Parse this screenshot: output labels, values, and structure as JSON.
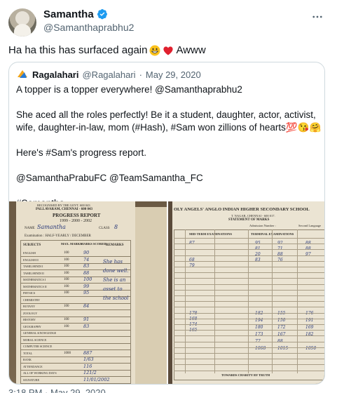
{
  "tweet": {
    "author_name": "Samantha",
    "author_handle": "@Samanthaprabhu2",
    "text": "Ha ha this has surfaced again",
    "text_tail": "Awww",
    "emojis": [
      "grinning-face",
      "red-heart"
    ]
  },
  "quote": {
    "author_name": "Ragalahari",
    "author_handle": "@Ragalahari",
    "separator": "·",
    "date": "May 29, 2020",
    "paragraphs": [
      "A topper is a topper everywhere! @Samanthaprabhu2",
      "She aced all the roles perfectly! Be it a student, daughter, actor, activist, wife, daughter-in-law, mom (#Hash), #Sam won zillions of hearts💯😘🤗",
      "Here's #Sam's progress report.",
      "@SamanthaPrabuFC @TeamSamantha_FC",
      "#Samantha"
    ]
  },
  "report_left": {
    "header_small": "RECOGNISED BY THE GOVT. 600 043",
    "header_place": "PALLAVARAM, CHENNAI - 600 043",
    "title": "PROGRESS REPORT",
    "year": "1999 - 2000 - 2002",
    "name_label": "NAME",
    "name_value": "Samantha",
    "class_label": "CLASS",
    "class_value": "8",
    "exam": "Examination : HALF-YEARLY / DECEMBER",
    "col_subjects": "SUBJECTS",
    "col_max": "MAX. MARKS",
    "col_scored": "MARKS SCORED",
    "col_remarks": "REMARKS",
    "subjects": [
      "ENGLISH",
      "ENGLISH II",
      "TAMIL/HINDI I",
      "TAMIL/HINDI II",
      "MATHEMATICS I",
      "MATHEMATICS II",
      "PHYSICS",
      "CHEMISTRY",
      "BOTANY",
      "ZOOLOGY",
      "HISTORY",
      "GEOGRAPHY",
      "GENERAL KNOWLEDGE",
      "MORAL SCIENCE",
      "COMPUTER SCIENCE",
      "TOTAL",
      "RANK",
      "ATTENDANCE",
      "ALL OF WORKING DAYS",
      "SIGNATURE"
    ],
    "max": [
      "100",
      "100",
      "100",
      "100",
      "100",
      "100",
      "100",
      "",
      "100",
      "",
      "100",
      "100",
      "",
      "",
      "",
      "1000",
      "",
      "",
      "",
      ""
    ],
    "scored": [
      "90",
      "74",
      "83",
      "88",
      "100",
      "99",
      "95",
      "",
      "84",
      "",
      "91",
      "83",
      "",
      "",
      "",
      "887",
      "1/63",
      "116",
      "121/2",
      "11/01/2002"
    ],
    "remarks": [
      "She has",
      "done well.",
      "She is an",
      "asset to",
      "the school"
    ]
  },
  "report_right": {
    "school": "OLY ANGELS' ANGLO INDIAN HIGHER SECONDARY SCHOOL",
    "address": "T. NAGAR, CHENNAI - 600 017.",
    "statement": "STATEMENT OF MARKS",
    "admission": "Admission Number :",
    "second_lang": "Second Language",
    "mid_term": "MID-TERM EXAMINATIONS",
    "terminal": "TERMINAL EXAMINATIONS",
    "mid_rows": [
      "87",
      "",
      "",
      "68",
      "79"
    ],
    "t1": [
      "95",
      "81",
      "20",
      "83"
    ],
    "t2": [
      "92",
      "71",
      "88",
      "76"
    ],
    "t3": [
      "88",
      "88",
      "97",
      ""
    ],
    "lower_mid": [
      "178",
      "168",
      "174",
      "165"
    ],
    "lower_a": [
      "182",
      "194",
      "180",
      "173",
      "77",
      "1068"
    ],
    "lower_b": [
      "155",
      "150",
      "172",
      "167",
      "88",
      "1015"
    ],
    "lower_c": [
      "176",
      "191",
      "169",
      "182",
      "",
      "1050"
    ],
    "footer": "TOWARDS CHARITY BY TRUTH"
  },
  "footer": {
    "time": "3:18 PM · May 29, 2020"
  }
}
